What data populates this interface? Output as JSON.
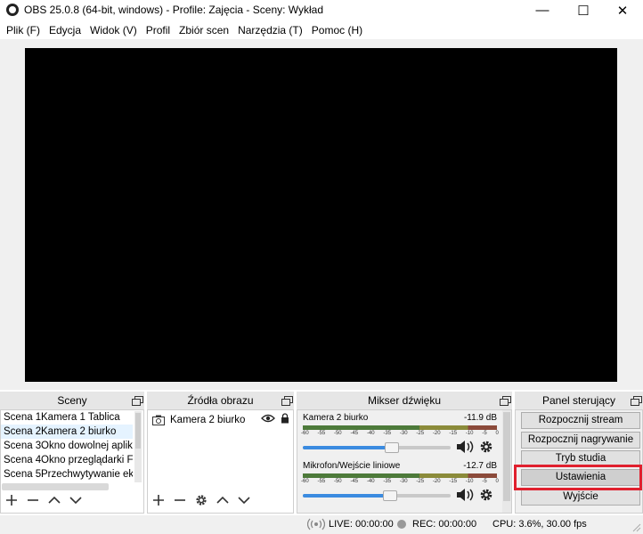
{
  "window": {
    "title": "OBS 25.0.8 (64-bit, windows) - Profile: Zajęcia - Sceny: Wykład",
    "minimize": "—",
    "maximize": "☐",
    "close": "✕"
  },
  "menu": [
    {
      "label": "Plik (F)"
    },
    {
      "label": "Edycja"
    },
    {
      "label": "Widok (V)"
    },
    {
      "label": "Profil"
    },
    {
      "label": "Zbiór scen"
    },
    {
      "label": "Narzędzia (T)"
    },
    {
      "label": "Pomoc (H)"
    }
  ],
  "scenes": {
    "title": "Sceny",
    "items": [
      {
        "num": "Scena 1",
        "name": "Kamera 1 Tablica"
      },
      {
        "num": "Scena 2",
        "name": "Kamera 2 biurko"
      },
      {
        "num": "Scena 3",
        "name": "Okno dowolnej aplikacji"
      },
      {
        "num": "Scena 4",
        "name": "Okno przeglądarki Firefox"
      },
      {
        "num": "Scena 5",
        "name": "Przechwytywanie ekranu"
      }
    ]
  },
  "sources": {
    "title": "Źródła obrazu",
    "items": [
      {
        "name": "Kamera 2 biurko"
      }
    ]
  },
  "mixer": {
    "title": "Mikser dźwięku",
    "ticks": [
      "-60",
      "-55",
      "-50",
      "-45",
      "-40",
      "-35",
      "-30",
      "-25",
      "-20",
      "-15",
      "-10",
      "-5",
      "0"
    ],
    "channels": [
      {
        "name": "Kamera 2 biurko",
        "db": "-11.9 dB",
        "volume": 0.6
      },
      {
        "name": "Mikrofon/Wejście liniowe",
        "db": "-12.7 dB",
        "volume": 0.59
      }
    ]
  },
  "controls": {
    "title": "Panel sterujący",
    "buttons": [
      {
        "label": "Rozpocznij stream"
      },
      {
        "label": "Rozpocznij nagrywanie"
      },
      {
        "label": "Tryb studia"
      },
      {
        "label": "Ustawienia"
      },
      {
        "label": "Wyjście"
      }
    ]
  },
  "status": {
    "live": "LIVE: 00:00:00",
    "rec": "REC: 00:00:00",
    "cpu": "CPU: 3.6%, 30.00 fps"
  },
  "colors": {
    "highlight": "#e0202e",
    "slider": "#3b8be0"
  }
}
